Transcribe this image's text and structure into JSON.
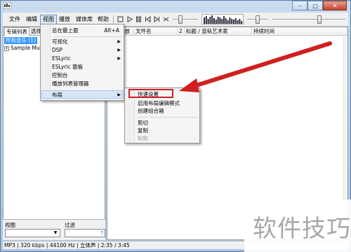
{
  "window": {
    "controls": {
      "minimize": "–",
      "maximize": "□",
      "close": "✕"
    }
  },
  "menubar": {
    "items": [
      "文件",
      "编辑",
      "视图",
      "播放",
      "媒体库",
      "帮助"
    ]
  },
  "toolbar": {
    "buttons": [
      "stop-icon",
      "play-icon",
      "pause-icon",
      "previous-icon",
      "next-icon",
      "random-icon"
    ]
  },
  "left_panel": {
    "tabs": [
      "专辑列表",
      "选择"
    ],
    "tree": {
      "root": "所有音乐 (1)",
      "child": "Sample Mu"
    },
    "view_label": "视图",
    "filter_label": "过滤",
    "filter_help": "?"
  },
  "playlist": {
    "columns": [
      "正在播放",
      "文件名",
      "2",
      "标题 / 音轨艺术家",
      "持续时间"
    ]
  },
  "view_menu": {
    "items": [
      {
        "label": "总在最上面",
        "shortcut": "Alt+A"
      },
      {
        "label": "可视化",
        "submenu": "▶"
      },
      {
        "label": "DSP",
        "submenu": "▶"
      },
      {
        "label": "ESLyric",
        "submenu": "▶"
      },
      {
        "label": "ESLyric 面板"
      },
      {
        "label": "控制台"
      },
      {
        "label": "播放列表管理器"
      },
      {
        "label": "布局",
        "submenu": "▶"
      }
    ]
  },
  "layout_menu": {
    "items": [
      {
        "label": "快速设置"
      },
      {
        "label": "启用布局编辑模式"
      },
      {
        "label": "创建组合箱"
      },
      {
        "label": "剪切"
      },
      {
        "label": "复制"
      },
      {
        "label": "粘贴",
        "disabled": true
      }
    ]
  },
  "status_bar": {
    "text": "MP3 | 320 kbps | 44100 Hz | 立体声 | 2:35 / 3:45"
  },
  "watermark": {
    "text": "软件技巧"
  },
  "colors": {
    "highlight": "#3399ff",
    "annotation_red": "#d0201e"
  }
}
